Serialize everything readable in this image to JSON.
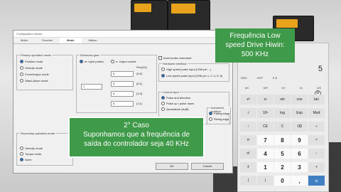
{
  "window": {
    "title": "Configuration wizard",
    "tabs": [
      "Motor",
      "Encoder",
      "Mode",
      "Motion"
    ],
    "primary_group": {
      "title": "Primary operation mode",
      "options": [
        "Position mode",
        "Velocity mode",
        "Force/torque mode",
        "Stand-alone mode"
      ],
      "selected": "Position mode"
    },
    "electronic_gear": {
      "title": "Electronic gear",
      "radio_pulses": "m: input pulses",
      "radio_counts": "n: output counts",
      "field_left": "1",
      "rows": [
        "5",
        "5",
        "5",
        "5"
      ],
      "row_labels": [
        "(0:0)",
        "(0:1)",
        "(1:0)",
        "(1:1)"
      ],
      "header": "Pins(14)"
    },
    "invert_pulse": "Invert pulse command",
    "interface": {
      "title": "Hardware interface",
      "option_high": "High speed pulse input (CN6 pin ...)",
      "option_low": "Low speed pulse input (CN6 pin 1, 2, 4, 5, 6)",
      "selected": "low"
    },
    "control_input": {
      "title": "Control input",
      "options": [
        "Pulse and direction",
        "Pulse up / pulse down",
        "Quadrature (AqB)"
      ],
      "selected": "Pulse and direction"
    },
    "increment": {
      "title": "Increment position",
      "options": [
        "Falling edge",
        "Rising edge"
      ],
      "selected": "Falling edge"
    },
    "secondary_group": {
      "title": "Secondary operation mode",
      "options": [
        "Velocity mode",
        "Torque mode",
        "None"
      ],
      "selected": "None"
    },
    "ok_label": "OK",
    "cancel_label": "Cancel"
  },
  "overlays": {
    "top": "Frequência Low speed Drive Hiwin: 500 KHz",
    "bottom_line1": "2° Caso",
    "bottom_line2": "Suponhamos que a frequência de",
    "bottom_line3": "saída do controlador seja 40 KHz"
  },
  "calculator": {
    "display": "5",
    "tabs": [
      "DEG",
      "HYP",
      "F-E"
    ],
    "memory": [
      "MC",
      "MR",
      "M+",
      "M-",
      "MS"
    ],
    "rows": [
      [
        "x²",
        "xʸ",
        "sin",
        "cos",
        "tan"
      ],
      [
        "√",
        "10ˣ",
        "log",
        "Exp",
        "Mod"
      ],
      [
        "↑",
        "CE",
        "C",
        "⌫",
        "÷"
      ],
      [
        "π",
        "7",
        "8",
        "9",
        "×"
      ],
      [
        "n!",
        "4",
        "5",
        "6",
        "−"
      ],
      [
        "±",
        "1",
        "2",
        "3",
        "+"
      ],
      [
        "(",
        ")",
        "0",
        ",",
        "="
      ]
    ]
  },
  "colors": {
    "overlay_green": "#3f9a49",
    "accent_blue": "#1a6cd0"
  }
}
